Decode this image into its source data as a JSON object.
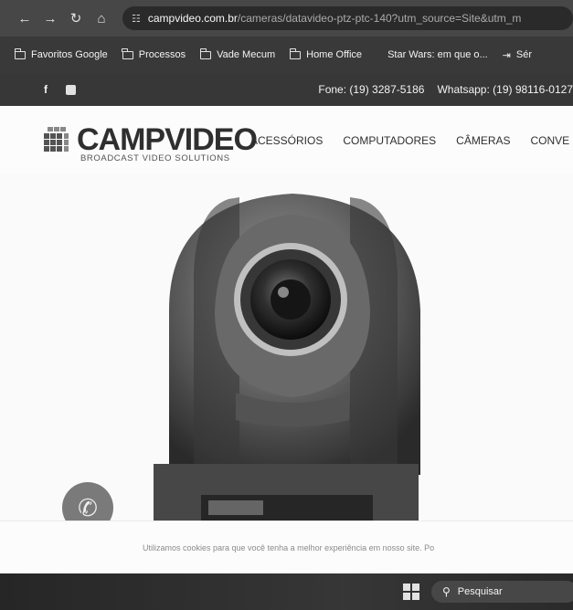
{
  "browser": {
    "back_icon": "arrow-left-icon",
    "forward_icon": "arrow-right-icon",
    "reload_icon": "reload-icon",
    "home_icon": "home-icon",
    "url_host": "campvideo.com.br",
    "url_path": "/cameras/datavideo-ptz-ptc-140?utm_source=Site&utm_m"
  },
  "bookmarks": [
    {
      "label": "Favoritos Google",
      "icon": "folder-icon"
    },
    {
      "label": "Processos",
      "icon": "folder-icon"
    },
    {
      "label": "Vade Mecum",
      "icon": "folder-icon"
    },
    {
      "label": "Home Office",
      "icon": "folder-icon"
    },
    {
      "label": "Star Wars: em que o...",
      "icon": "page-icon"
    },
    {
      "label": "Sér",
      "icon": "page-icon"
    }
  ],
  "topbar": {
    "facebook": "f",
    "phone": "Fone: (19) 3287-5186",
    "whatsapp": "Whatsapp: (19) 98116-0127"
  },
  "header": {
    "logo_text": "CAMPVIDEO",
    "logo_tagline": "BROADCAST VIDEO SOLUTIONS",
    "menu": [
      "ACESSÓRIOS",
      "COMPUTADORES",
      "CÂMERAS",
      "CONVE"
    ]
  },
  "cookie_text": "Utilizamos cookies para que você tenha a melhor experiência em nosso site. Po",
  "taskbar": {
    "start_icon": "windows-icon",
    "search_placeholder": "Pesquisar"
  },
  "colors": {
    "browser_bar": "#4a4a4a",
    "bookmarks_bar": "#3c3c3c",
    "site_topbar": "#3a3a3a",
    "page_bg": "#f4f4f2"
  }
}
